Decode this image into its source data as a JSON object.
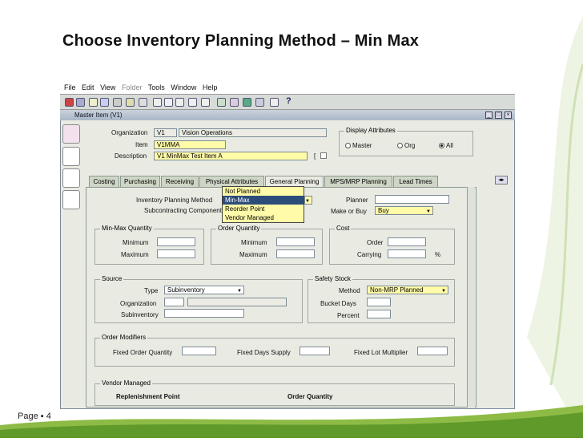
{
  "slide": {
    "title": "Choose Inventory Planning Method – Min Max",
    "page": "Page ▪ 4"
  },
  "menu": [
    "File",
    "Edit",
    "View",
    "Folder",
    "Tools",
    "Window",
    "Help"
  ],
  "window": {
    "title": "Master Item (V1)"
  },
  "header": {
    "org_label": "Organization",
    "org_code": "V1",
    "org_name": "Vision Operations",
    "item_label": "Item",
    "item_value": "V1MMA",
    "desc_label": "Description",
    "desc_value": "V1 MinMax Test Item A",
    "desc_bracket": "[",
    "display_title": "Display Attributes",
    "radio_master": "Master",
    "radio_org": "Org",
    "radio_all": "All"
  },
  "tabs": [
    "Costing",
    "Purchasing",
    "Receiving",
    "Physical Attributes",
    "General Planning",
    "MPS/MRP Planning",
    "Lead Times"
  ],
  "planning": {
    "method_label": "Inventory Planning Method",
    "sub_label": "Subcontracting Component",
    "options": [
      "Not Planned",
      "Min-Max",
      "Reorder Point",
      "Vendor Managed"
    ],
    "planner_label": "Planner",
    "make_buy_label": "Make or Buy",
    "make_buy_value": "Buy"
  },
  "minmax": {
    "title": "Min-Max Quantity",
    "min": "Minimum",
    "max": "Maximum"
  },
  "orderqty": {
    "title": "Order Quantity",
    "min": "Minimum",
    "max": "Maximum"
  },
  "cost": {
    "title": "Cost",
    "order": "Order",
    "carrying": "Carrying",
    "pct": "%"
  },
  "source": {
    "title": "Source",
    "type_label": "Type",
    "type_value": "Subinventory",
    "org_label": "Organization",
    "sub_label": "Subinventory"
  },
  "safety": {
    "title": "Safety Stock",
    "method_label": "Method",
    "method_value": "Non-MRP Planned",
    "bucket_label": "Bucket Days",
    "pct_label": "Percent"
  },
  "modifiers": {
    "title": "Order Modifiers",
    "fixed_order": "Fixed Order Quantity",
    "fixed_days": "Fixed Days Supply",
    "fixed_lot": "Fixed Lot Multiplier"
  },
  "vendor": {
    "title": "Vendor Managed",
    "replen": "Replenishment Point",
    "order_qty": "Order Quantity"
  },
  "colors": {
    "accent": "#7db23a",
    "required": "#fffba8",
    "highlight": "#2c4d7a"
  }
}
